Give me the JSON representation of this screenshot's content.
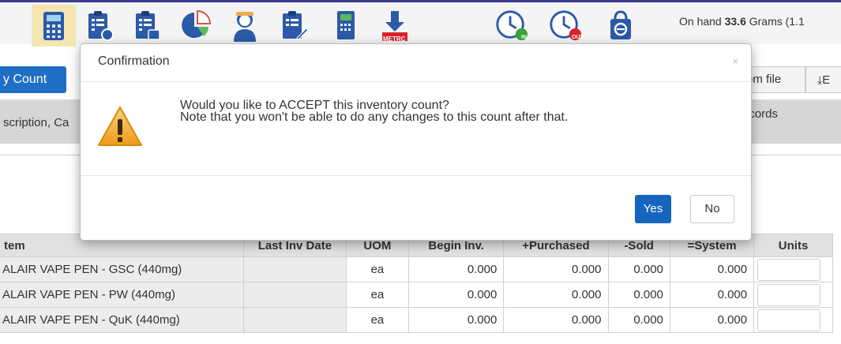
{
  "toolbar": {
    "icons": [
      "calculator-icon",
      "clipboard-user-icon",
      "clipboard-list-icon",
      "pie-chart-icon",
      "worker-icon",
      "clipboard-edit-icon",
      "scale-icon",
      "metrc-download-icon",
      "clock-in-icon",
      "clock-out-icon",
      "shopping-bag-icon"
    ],
    "metrc_label": "METRC",
    "in_label": "IN",
    "out_label": "OUT",
    "onhand_prefix": "On hand ",
    "onhand_value": "33.6",
    "onhand_suffix": " Grams (1.1"
  },
  "actions": {
    "count_button": "y Count",
    "from_file": "om file",
    "export_label": "E"
  },
  "filter": {
    "search_value": "scription, Ca",
    "records": "ecords"
  },
  "table": {
    "columns": [
      "tem",
      "Last Inv Date",
      "UOM",
      "Begin Inv.",
      "+Purchased",
      "-Sold",
      "=System",
      "Units"
    ],
    "rows": [
      {
        "item": "ALAIR VAPE PEN - GSC (440mg)",
        "last_inv": "",
        "uom": "ea",
        "begin": "0.000",
        "purchased": "0.000",
        "sold": "0.000",
        "system": "0.000"
      },
      {
        "item": "ALAIR VAPE PEN - PW (440mg)",
        "last_inv": "",
        "uom": "ea",
        "begin": "0.000",
        "purchased": "0.000",
        "sold": "0.000",
        "system": "0.000"
      },
      {
        "item": "ALAIR VAPE PEN - QuK (440mg)",
        "last_inv": "",
        "uom": "ea",
        "begin": "0.000",
        "purchased": "0.000",
        "sold": "0.000",
        "system": "0.000"
      }
    ]
  },
  "modal": {
    "title": "Confirmation",
    "close": "×",
    "line1": "Would you like to ACCEPT this inventory count?",
    "line2": "Note that you won't be able to do any changes to this count after that.",
    "yes": "Yes",
    "no": "No",
    "icon": "warning-icon"
  },
  "colors": {
    "primary": "#1565c0",
    "toolbar_active": "#f3e6b3",
    "warning": "#f5a623"
  }
}
